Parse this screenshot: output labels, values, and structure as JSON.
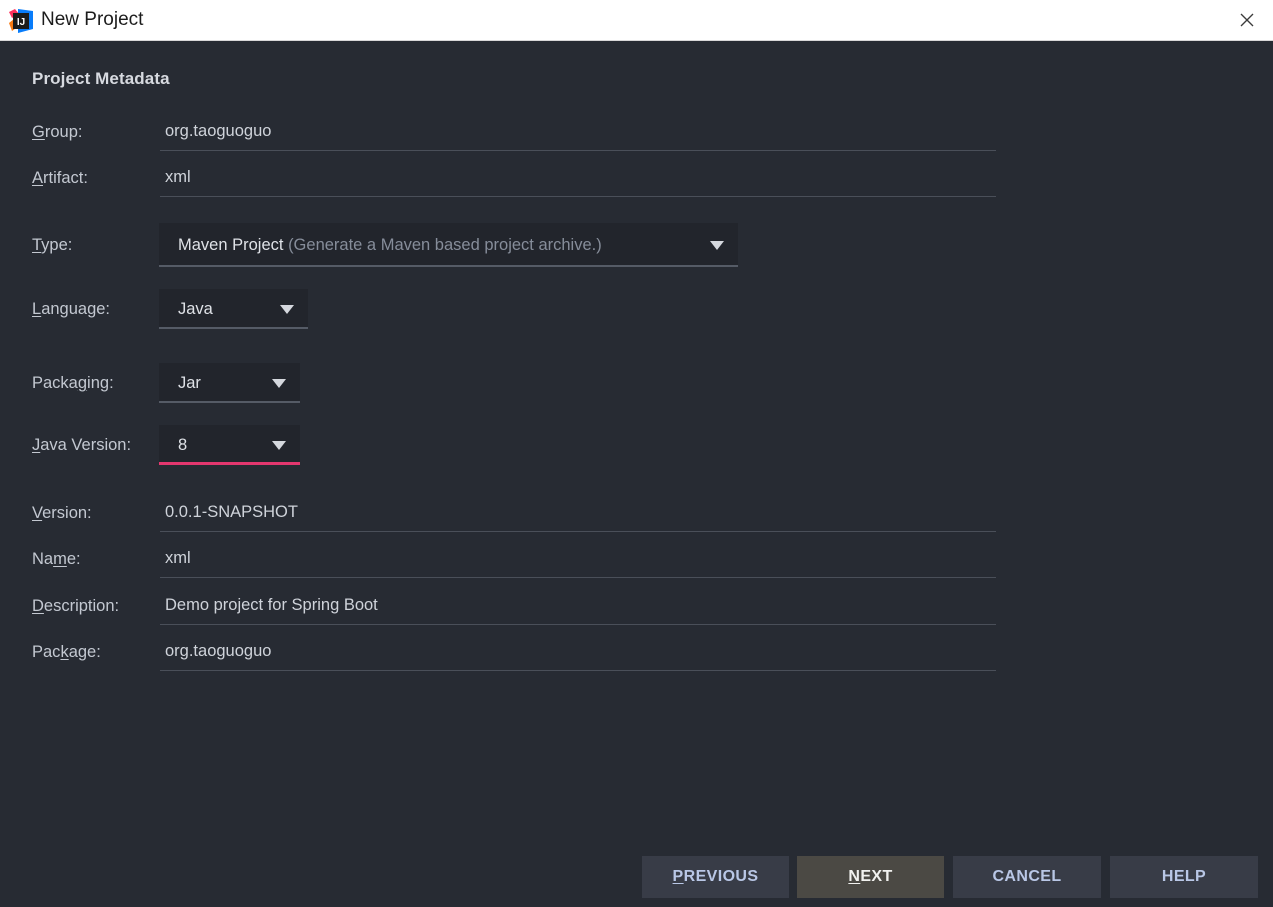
{
  "window": {
    "title": "New Project",
    "logo_icon": "intellij-idea-logo",
    "close_icon": "close-icon"
  },
  "form": {
    "section_title": "Project Metadata",
    "fields": [
      {
        "id": "group",
        "label_pre": "",
        "label_mnemonic": "G",
        "label_post": "roup:",
        "type": "text",
        "value": "org.taoguoguo"
      },
      {
        "id": "artifact",
        "label_pre": "",
        "label_mnemonic": "A",
        "label_post": "rtifact:",
        "type": "text",
        "value": "xml"
      },
      {
        "id": "type",
        "label_pre": "",
        "label_mnemonic": "T",
        "label_post": "ype:",
        "type": "combo",
        "value": "Maven Project",
        "hint": "(Generate a Maven based project archive.)",
        "focused": false,
        "arrow_icon": "chevron-down-icon"
      },
      {
        "id": "language",
        "label_pre": "",
        "label_mnemonic": "L",
        "label_post": "anguage:",
        "type": "combo",
        "value": "Java",
        "hint": "",
        "focused": false,
        "arrow_icon": "chevron-down-icon"
      },
      {
        "id": "packaging",
        "label_pre": "Packa",
        "label_mnemonic": "g",
        "label_post": "ing:",
        "type": "combo",
        "value": "Jar",
        "hint": "",
        "focused": false,
        "arrow_icon": "chevron-down-icon"
      },
      {
        "id": "java-version",
        "label_pre": "",
        "label_mnemonic": "J",
        "label_post": "ava Version:",
        "type": "combo",
        "value": "8",
        "hint": "",
        "focused": true,
        "arrow_icon": "chevron-down-icon"
      },
      {
        "id": "version",
        "label_pre": "",
        "label_mnemonic": "V",
        "label_post": "ersion:",
        "type": "text",
        "value": "0.0.1-SNAPSHOT"
      },
      {
        "id": "name",
        "label_pre": "Na",
        "label_mnemonic": "m",
        "label_post": "e:",
        "type": "text",
        "value": "xml"
      },
      {
        "id": "description",
        "label_pre": "",
        "label_mnemonic": "D",
        "label_post": "escription:",
        "type": "text",
        "value": "Demo project for Spring Boot"
      },
      {
        "id": "package",
        "label_pre": "Pac",
        "label_mnemonic": "k",
        "label_post": "age:",
        "type": "text",
        "value": "org.taoguoguo"
      }
    ]
  },
  "buttons": [
    {
      "id": "previous",
      "pre": "",
      "mnemonic": "P",
      "post": "REVIOUS",
      "state": "normal"
    },
    {
      "id": "next",
      "pre": "",
      "mnemonic": "N",
      "post": "EXT",
      "state": "hovered"
    },
    {
      "id": "cancel",
      "pre": "CANCEL",
      "mnemonic": "",
      "post": "",
      "state": "normal"
    },
    {
      "id": "help",
      "pre": "HELP",
      "mnemonic": "",
      "post": "",
      "state": "normal"
    }
  ],
  "colors": {
    "dialog_background": "#272b33",
    "titlebar_background": "#ffffff",
    "focus_underline": "#e4376f",
    "button_background": "#383c47",
    "button_hover_background": "#4b4944",
    "button_text": "#b9c7e6",
    "label_text": "#c3c8d1",
    "value_text": "#cfd3da",
    "hint_text": "#868d9a"
  }
}
